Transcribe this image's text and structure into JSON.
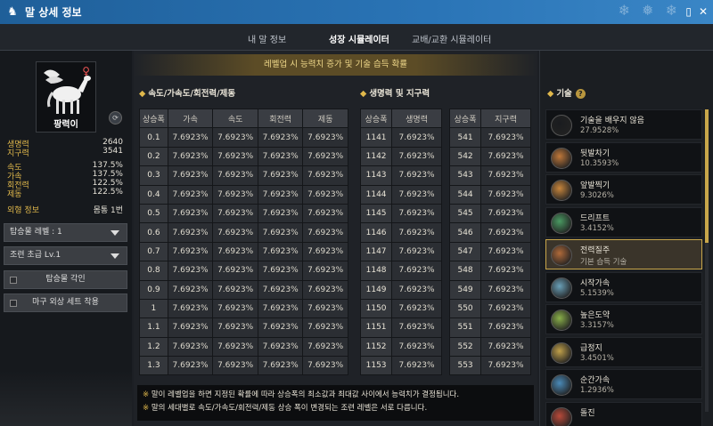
{
  "window": {
    "title": "말 상세 정보"
  },
  "tabs": [
    {
      "label": "내 말 정보",
      "active": false
    },
    {
      "label": "성장 시뮬레이터",
      "active": true
    },
    {
      "label": "교배/교환 시뮬레이터",
      "active": false
    }
  ],
  "horse": {
    "name": "팡력이",
    "gender_icon": "female-icon",
    "stats": [
      {
        "label": "생명력",
        "value": "2640"
      },
      {
        "label": "지구력",
        "value": "3541"
      }
    ],
    "speed_stats": [
      {
        "label": "속도",
        "value": "137.5%"
      },
      {
        "label": "가속",
        "value": "137.5%"
      },
      {
        "label": "회전력",
        "value": "122.5%"
      },
      {
        "label": "제동",
        "value": "122.5%"
      }
    ],
    "appearance": {
      "label": "외형 정보",
      "value": "몸통 1번"
    }
  },
  "controls": {
    "mount_level": "탑승물 레벨 : 1",
    "trainer": "조련 초급 Lv.1",
    "engrave_button": "탑승물 각인",
    "armor_button": "마구 외상 세트 착용"
  },
  "banner": "레벨업 시 능력치 증가 및 기술 습득 확률",
  "speed_section": {
    "title": "속도/가속도/회전력/제동",
    "headers": [
      "상승폭",
      "가속",
      "속도",
      "회전력",
      "제동"
    ],
    "rows": [
      [
        "0.1",
        "7.6923%",
        "7.6923%",
        "7.6923%",
        "7.6923%"
      ],
      [
        "0.2",
        "7.6923%",
        "7.6923%",
        "7.6923%",
        "7.6923%"
      ],
      [
        "0.3",
        "7.6923%",
        "7.6923%",
        "7.6923%",
        "7.6923%"
      ],
      [
        "0.4",
        "7.6923%",
        "7.6923%",
        "7.6923%",
        "7.6923%"
      ],
      [
        "0.5",
        "7.6923%",
        "7.6923%",
        "7.6923%",
        "7.6923%"
      ],
      [
        "0.6",
        "7.6923%",
        "7.6923%",
        "7.6923%",
        "7.6923%"
      ],
      [
        "0.7",
        "7.6923%",
        "7.6923%",
        "7.6923%",
        "7.6923%"
      ],
      [
        "0.8",
        "7.6923%",
        "7.6923%",
        "7.6923%",
        "7.6923%"
      ],
      [
        "0.9",
        "7.6923%",
        "7.6923%",
        "7.6923%",
        "7.6923%"
      ],
      [
        "1",
        "7.6923%",
        "7.6923%",
        "7.6923%",
        "7.6923%"
      ],
      [
        "1.1",
        "7.6923%",
        "7.6923%",
        "7.6923%",
        "7.6923%"
      ],
      [
        "1.2",
        "7.6923%",
        "7.6923%",
        "7.6923%",
        "7.6923%"
      ],
      [
        "1.3",
        "7.6923%",
        "7.6923%",
        "7.6923%",
        "7.6923%"
      ]
    ]
  },
  "hp_section": {
    "title": "생명력 및 지구력",
    "hp_headers": [
      "상승폭",
      "생명력"
    ],
    "hp_rows": [
      [
        "1141",
        "7.6923%"
      ],
      [
        "1142",
        "7.6923%"
      ],
      [
        "1143",
        "7.6923%"
      ],
      [
        "1144",
        "7.6923%"
      ],
      [
        "1145",
        "7.6923%"
      ],
      [
        "1146",
        "7.6923%"
      ],
      [
        "1147",
        "7.6923%"
      ],
      [
        "1148",
        "7.6923%"
      ],
      [
        "1149",
        "7.6923%"
      ],
      [
        "1150",
        "7.6923%"
      ],
      [
        "1151",
        "7.6923%"
      ],
      [
        "1152",
        "7.6923%"
      ],
      [
        "1153",
        "7.6923%"
      ]
    ],
    "st_headers": [
      "상승폭",
      "지구력"
    ],
    "st_rows": [
      [
        "541",
        "7.6923%"
      ],
      [
        "542",
        "7.6923%"
      ],
      [
        "543",
        "7.6923%"
      ],
      [
        "544",
        "7.6923%"
      ],
      [
        "545",
        "7.6923%"
      ],
      [
        "546",
        "7.6923%"
      ],
      [
        "547",
        "7.6923%"
      ],
      [
        "548",
        "7.6923%"
      ],
      [
        "549",
        "7.6923%"
      ],
      [
        "550",
        "7.6923%"
      ],
      [
        "551",
        "7.6923%"
      ],
      [
        "552",
        "7.6923%"
      ],
      [
        "553",
        "7.6923%"
      ]
    ]
  },
  "notes": [
    "말이 레벨업을 하면 지정된 확률에 따라 상승폭의 최소값과 최대값 사이에서 능력치가 결정됩니다.",
    "말의 세대별로 속도/가속도/회전력/제동 상승 폭이 변경되는 조련 레벨은 서로 다릅니다."
  ],
  "skills_section": {
    "title": "기술",
    "items": [
      {
        "name": "기술을 배우지 않음",
        "value": "27.9528%",
        "icon": "empty-slot-icon",
        "color": "#1a1c1f",
        "selected": false
      },
      {
        "name": "뒷발차기",
        "value": "10.3593%",
        "icon": "back-kick-icon",
        "color": "#c0783a",
        "selected": false
      },
      {
        "name": "앞발찍기",
        "value": "9.3026%",
        "icon": "front-stomp-icon",
        "color": "#c8863c",
        "selected": false
      },
      {
        "name": "드리프트",
        "value": "3.4152%",
        "icon": "drift-icon",
        "color": "#4a9a62",
        "selected": false
      },
      {
        "name": "전력질주",
        "value": "기본 습득 기술",
        "icon": "sprint-icon",
        "color": "#b06a3a",
        "selected": true
      },
      {
        "name": "시작가속",
        "value": "5.1539%",
        "icon": "start-accel-icon",
        "color": "#6aa0b8",
        "selected": false
      },
      {
        "name": "높은도약",
        "value": "3.3157%",
        "icon": "high-jump-icon",
        "color": "#8ab04a",
        "selected": false
      },
      {
        "name": "급정지",
        "value": "3.4501%",
        "icon": "sudden-stop-icon",
        "color": "#c0a04a",
        "selected": false
      },
      {
        "name": "순간가속",
        "value": "1.2936%",
        "icon": "instant-accel-icon",
        "color": "#4a8ab8",
        "selected": false
      },
      {
        "name": "돌진",
        "value": "",
        "icon": "charge-icon",
        "color": "#b84a3a",
        "selected": false
      }
    ]
  }
}
